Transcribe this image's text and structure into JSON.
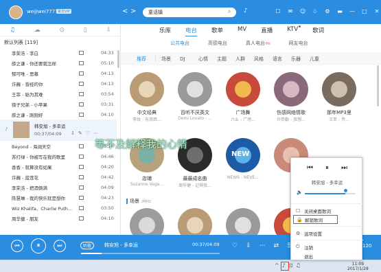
{
  "header": {
    "username": "weijiwei7777",
    "vip_badge": "豪华VIP",
    "back_icon": "<",
    "forward_icon": ">",
    "refresh_icon": "↻",
    "search_value": "童话镇",
    "search_icon": "⌕",
    "mic_icon": "♪",
    "icons": [
      "☐",
      "✉",
      "☺",
      "♧",
      "⚙",
      "▬",
      "—",
      "□",
      "✕"
    ]
  },
  "left_panel": {
    "tab_icons": [
      "♫",
      "☁",
      "⊙",
      "▯",
      "⇩"
    ],
    "list_header": "默认列表 [119]",
    "songs": [
      {
        "title": "李荣浩 - 李白",
        "duration": "04:33"
      },
      {
        "title": "薛之谦 - 你还要我怎样",
        "duration": "05:10"
      },
      {
        "title": "郁可唯 - 思慕",
        "duration": "04:13"
      },
      {
        "title": "许巍 - 曾经的你",
        "duration": "04:13"
      },
      {
        "title": "王菲 - 給为其难",
        "duration": "03:54"
      },
      {
        "title": "筷子兄弟 - 小苹果",
        "duration": "03:31"
      },
      {
        "title": "薛之谦 - 刚刚好",
        "duration": "04:10"
      }
    ],
    "playing": {
      "index_marker": "♪",
      "title": "韩安旭 - 多幸运",
      "progress": "00:37/04:09",
      "actions": [
        "⇩",
        "✎",
        "♡",
        "⋯"
      ]
    },
    "songs_after": [
      {
        "title": "Beyond - 海阔天空",
        "duration": "05:26"
      },
      {
        "title": "苏打绿 - 你被写在我的歌里",
        "duration": "04:46"
      },
      {
        "title": "香香 - 就算没有如果",
        "duration": "04:20"
      },
      {
        "title": "许巍 - 蓝莲花",
        "duration": "04:42"
      },
      {
        "title": "李荣浩 - 把酒倒满",
        "duration": "04:09"
      },
      {
        "title": "陈慧琳 - 我的快乐就是想你",
        "duration": "04:23"
      },
      {
        "title": "Wiz Khalifa、Charlie Puth...",
        "duration": "03:50"
      },
      {
        "title": "周华健 - 朋友",
        "duration": "04:10"
      }
    ]
  },
  "main": {
    "tabs": [
      "乐库",
      "电台",
      "歌单",
      "MV",
      "直播",
      "KTV",
      "歌词"
    ],
    "active_tab": "电台",
    "subtabs": [
      "公共电台",
      "高德电台",
      "真人电台",
      "网友电台"
    ],
    "fm_badge": "fm",
    "categories": [
      "推荐",
      "场景",
      "DJ",
      "心情",
      "主题",
      "人群",
      "风格",
      "语言",
      "乐器",
      "儿童"
    ],
    "stations": [
      {
        "name": "中文经典",
        "sub": "李玟 - 东南西...",
        "color": "#b99b76",
        "inner": "#e8d6b8"
      },
      {
        "name": "百听不厌英文",
        "sub": "Demi Lovato - ...",
        "color": "#9a9a9a",
        "inner": "#e0e0e0"
      },
      {
        "name": "广场舞",
        "sub": "六幺 - 广场...",
        "color": "#c74a3a",
        "inner": "#f0b94d"
      },
      {
        "name": "伤感网络情歌",
        "sub": "许恭勤 - 我想...",
        "color": "#8a6a7a",
        "inner": "#d9b8c4"
      },
      {
        "name": "那年MP3里",
        "sub": "王菲 - 传...",
        "color": "#7a6b5e",
        "inner": "#cdbfb2"
      },
      {
        "name": "店铺",
        "sub": "Suzanne Vega...",
        "color": "#b7a27b",
        "inner": "#7bb0a8"
      },
      {
        "name": "最最成名曲",
        "sub": "周华健 - 记得我...",
        "color": "#2a2a2a",
        "inner": "#6e6e6e"
      },
      {
        "name": "NEW",
        "sub": "NEWS - NEVE...",
        "color": "#1d5aa8",
        "inner": "#5fb2e8"
      },
      {
        "name": "",
        "sub": "",
        "color": "#c98a7a",
        "inner": "#e9c1b0"
      },
      {
        "name": "",
        "sub": "",
        "color": "#9c9c9c",
        "inner": "#dadada"
      }
    ],
    "section2_title": "场景",
    "section2_unit": ".MHz"
  },
  "lyric": "等不及解释我的心情",
  "player": {
    "prev_icon": "⏮",
    "pause_icon": "⏸",
    "next_icon": "⏭",
    "mode": "听歌",
    "now_playing": "韩安旭 - 多幸运",
    "time": "00:37/04:09",
    "progress_fraction": 0.148,
    "icons": [
      "♡",
      "⇩",
      "⋯",
      "⇄",
      "☰"
    ],
    "count": "120"
  },
  "popup": {
    "prev": "⏮",
    "pause": "⏸",
    "next": "⏭",
    "title": "韩安旭 - 多幸运",
    "volume_fraction": 0.8,
    "items": [
      {
        "icon": "☐",
        "label": "关闭桌面歌词",
        "highlight": false
      },
      {
        "icon": "🔒",
        "label": "解锁歌词",
        "highlight": true
      },
      {
        "icon": "⚙",
        "label": "选项设置",
        "highlight": false
      },
      {
        "icon": "⏻",
        "label": "注销",
        "highlight": false
      },
      {
        "icon": "",
        "label": "退出",
        "highlight": false
      }
    ]
  },
  "taskbar": {
    "tray_icons": [
      "^",
      "♪",
      "⊡",
      "♫"
    ],
    "time": "11:09",
    "date": "2017/1/28"
  }
}
